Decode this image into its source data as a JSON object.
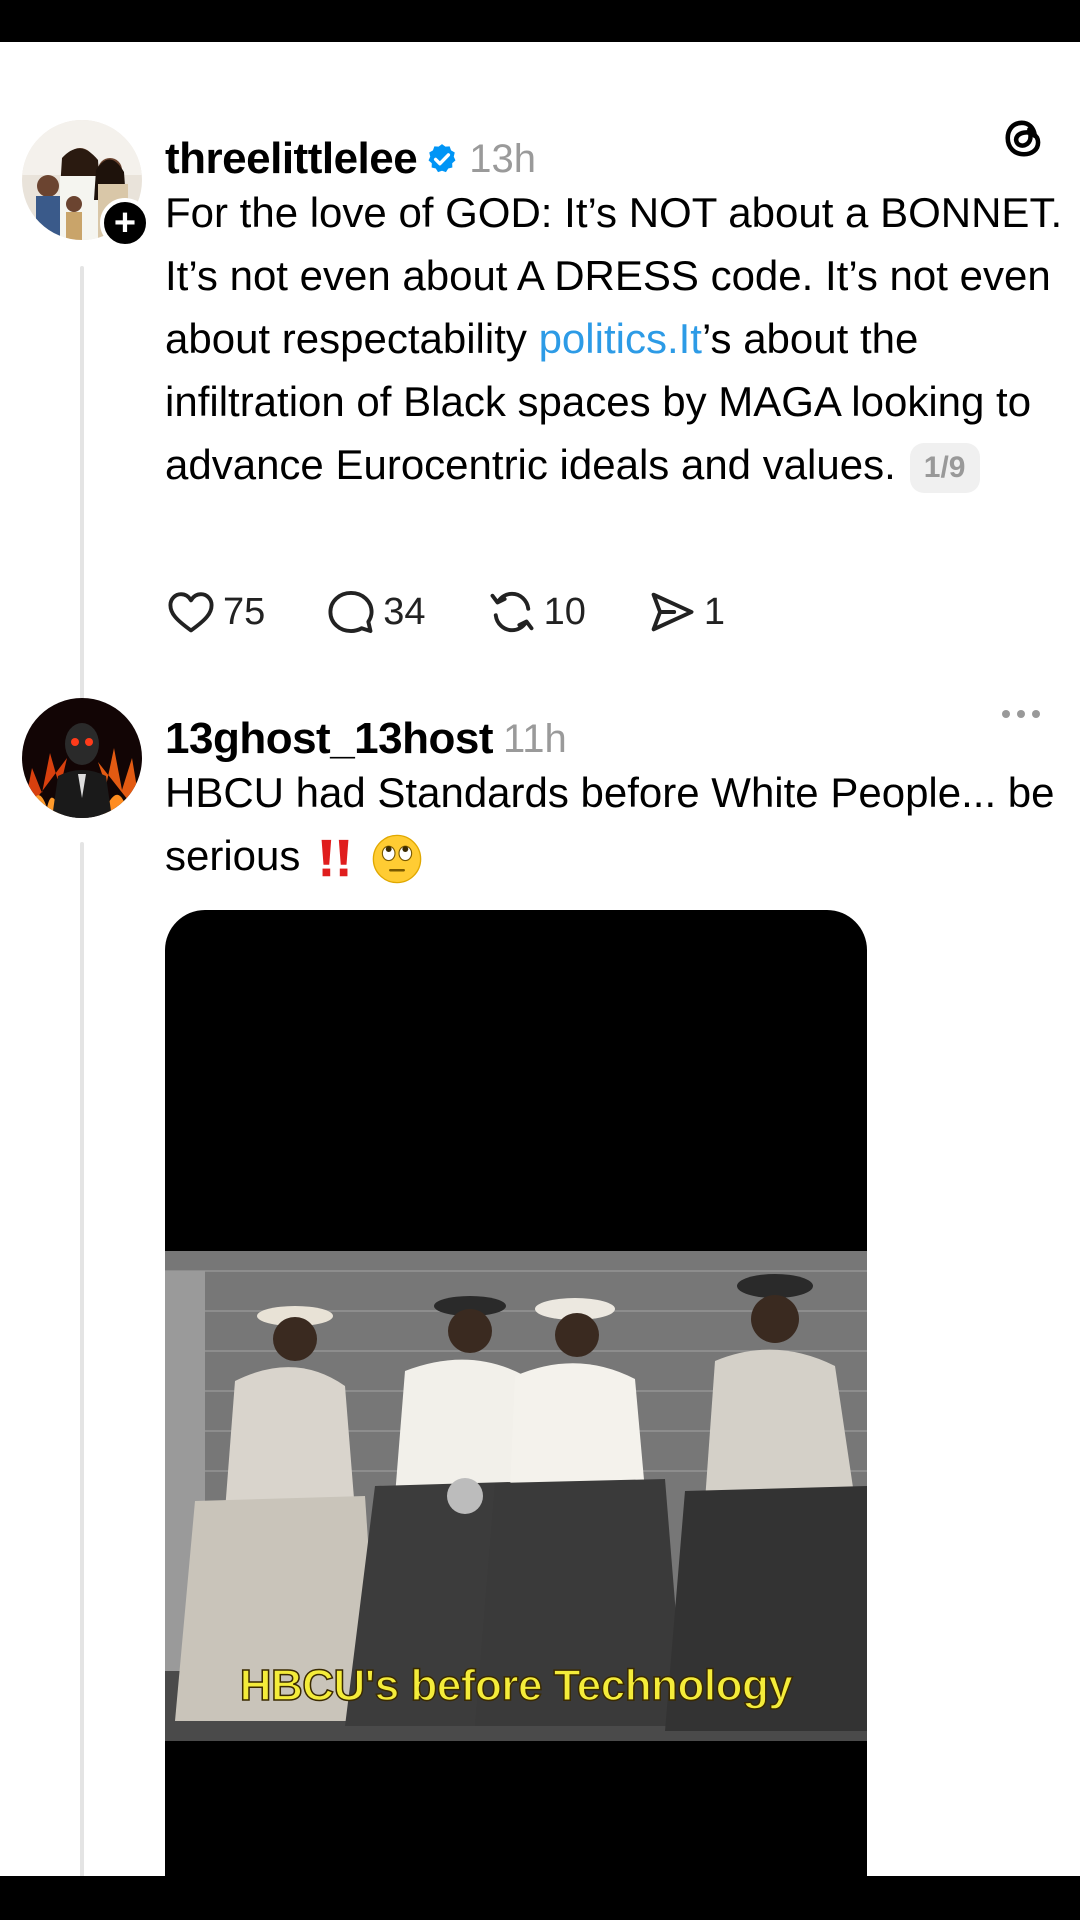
{
  "posts": [
    {
      "username": "threelittlelee",
      "timestamp": "13h",
      "verified": true,
      "text_before_link": "For the love of GOD: It’s NOT about a BONNET. It’s not even about A DRESS code. It’s not even about respectability ",
      "link_text": "politics.It",
      "text_after_link": "’s about the infiltration of Black spaces by MAGA looking to advance Eurocentric ideals and values.",
      "thread_counter": "1/9",
      "likes": "75",
      "replies": "34",
      "reposts": "10",
      "shares": "1"
    },
    {
      "username": "13ghost_13host",
      "timestamp": "11h",
      "text": "HBCU had Standards before White People... be serious",
      "media_caption": "HBCU's before Technology"
    }
  ],
  "icons": {
    "brand": "threads-logo-icon",
    "verified": "verified-badge-icon",
    "follow": "plus-icon",
    "like": "heart-icon",
    "reply": "comment-icon",
    "repost": "repost-icon",
    "share": "send-icon",
    "more": "more-options-icon",
    "emoji_1": "double-exclamation-icon",
    "emoji_2": "eye-roll-emoji-icon"
  },
  "colors": {
    "link": "#2d9be6",
    "verified": "#0095f6",
    "muted": "#9a9a9a",
    "caption": "#f4ec3a"
  }
}
